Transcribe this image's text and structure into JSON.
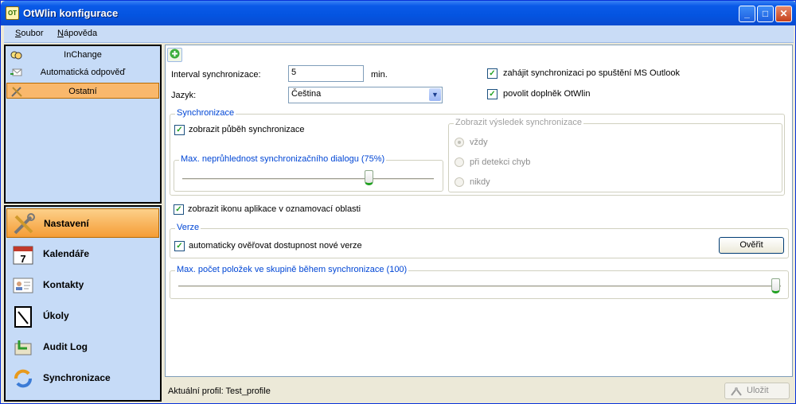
{
  "window": {
    "title": "OtWlin konfigurace",
    "icon_text": "OT",
    "min": "_",
    "max": "□",
    "close": "✕"
  },
  "menu": {
    "soubor": "Soubor",
    "soubor_key": "S",
    "soubor_rest": "oubor",
    "napoveda": "Nápověda",
    "napoveda_key": "N",
    "napoveda_rest": "ápověda"
  },
  "accounts": [
    {
      "label": "InChange",
      "icon": "inchange-icon"
    },
    {
      "label": "Automatická odpověď",
      "icon": "auto-reply-icon"
    },
    {
      "label": "Ostatní",
      "icon": "tools-icon"
    }
  ],
  "nav": [
    {
      "label": "Nastavení",
      "icon": "settings-icon",
      "glyph": "🔧"
    },
    {
      "label": "Kalendáře",
      "icon": "calendar-icon",
      "glyph": "7"
    },
    {
      "label": "Kontakty",
      "icon": "contacts-icon",
      "glyph": "▤"
    },
    {
      "label": "Úkoly",
      "icon": "tasks-icon",
      "glyph": "✎"
    },
    {
      "label": "Audit Log",
      "icon": "audit-log-icon",
      "glyph": "✉"
    },
    {
      "label": "Synchronizace",
      "icon": "sync-icon",
      "glyph": "⟳"
    }
  ],
  "settings": {
    "interval_label": "Interval synchronizace:",
    "interval_value": "5",
    "interval_unit": "min.",
    "language_label": "Jazyk:",
    "language_value": "Čeština",
    "start_sync_label": "zahájit synchronizaci po spuštění MS Outlook",
    "start_sync_checked": true,
    "enable_addin_label": "povolit doplněk OtWlin",
    "enable_addin_checked": true
  },
  "sync_group": {
    "legend": "Synchronizace",
    "show_progress_label": "zobrazit půběh synchronizace",
    "show_progress_checked": true,
    "opacity_legend": "Max. neprůhlednost synchronizačního dialogu (75%)",
    "opacity_value": 75,
    "result_legend": "Zobrazit výsledek synchronizace",
    "result_options": [
      "vždy",
      "při detekci chyb",
      "nikdy"
    ],
    "result_selected": "vždy"
  },
  "tray_icon_label": "zobrazit ikonu aplikace v oznamovací oblasti",
  "tray_icon_checked": true,
  "version_group": {
    "legend": "Verze",
    "auto_check_label": "automaticky ověřovat dostupnost nové verze",
    "auto_check_checked": true,
    "verify_button": "Ověřit"
  },
  "max_items_group": {
    "legend": "Max. počet položek ve skupině během synchronizace (100)",
    "value": 100
  },
  "status": {
    "profile_text": "Aktuální profil: Test_profile",
    "save_button": "Uložit"
  },
  "colors": {
    "accent": "#0046d5",
    "selected": "#f9b86c",
    "check": "#21a121"
  }
}
